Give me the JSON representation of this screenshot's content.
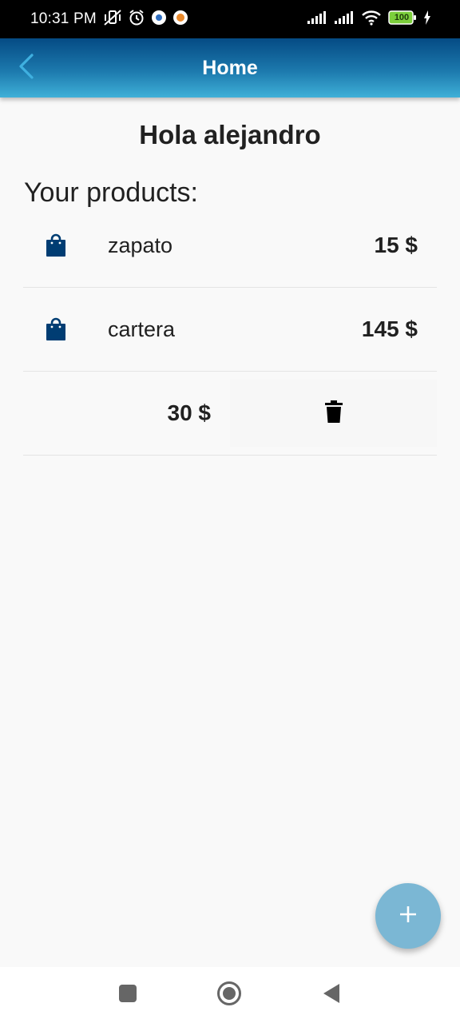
{
  "status_bar": {
    "time": "10:31 PM",
    "battery": "100",
    "left_icons": [
      "vibrate-off-icon",
      "alarm-icon",
      "app-notification-icon",
      "app-notification-icon"
    ],
    "right_icons": [
      "signal-icon",
      "signal-icon",
      "wifi-icon",
      "battery-icon",
      "charging-icon"
    ]
  },
  "app_bar": {
    "title": "Home",
    "back_icon": "chevron-left-icon"
  },
  "greeting": "Hola alejandro",
  "products_title": "Your products:",
  "products": [
    {
      "name": "zapato",
      "price": "15 $",
      "icon": "shopping-bag-icon"
    },
    {
      "name": "cartera",
      "price": "145 $",
      "icon": "shopping-bag-icon"
    }
  ],
  "swiped_item": {
    "price": "30 $",
    "action_icon": "trash-icon"
  },
  "fab": {
    "icon": "plus-icon"
  },
  "nav_bar": {
    "icons": [
      "recents-square-icon",
      "home-circle-icon",
      "back-triangle-icon"
    ]
  },
  "colors": {
    "app_bar_top": "#054b84",
    "app_bar_bottom": "#3fb0d8",
    "bag_icon": "#003d73",
    "fab": "#7bb7d4",
    "back_chevron": "#3fb0e0"
  }
}
